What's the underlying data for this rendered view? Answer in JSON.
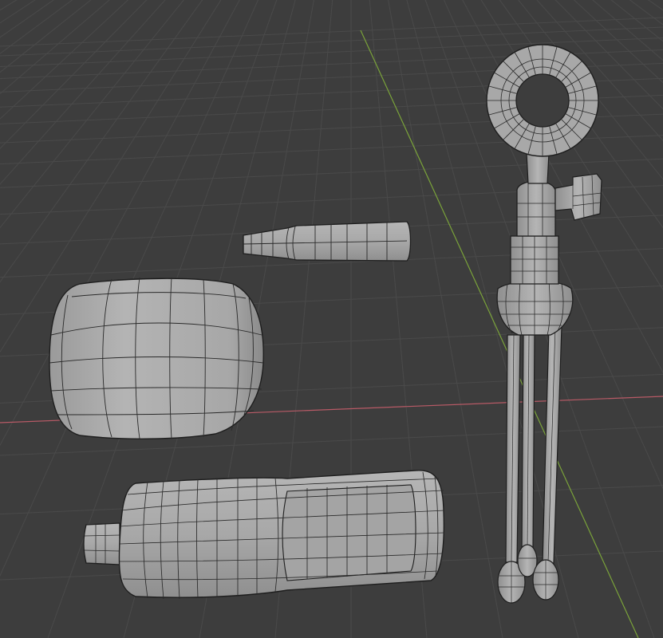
{
  "viewport": {
    "view": "3d-viewport",
    "shading": "solid",
    "overlay": "wireframe",
    "background_color": "#3d3d3d",
    "grid_color": "#4a4a4a",
    "x_axis_color": "#b85a66",
    "y_axis_color": "#7aa23a",
    "mesh_fill_color": "#a9a9a9",
    "mesh_wire_color": "#1e1e1e"
  },
  "objects": [
    {
      "name": "mic-head-mesh"
    },
    {
      "name": "connector-pin-mesh"
    },
    {
      "name": "mic-body-mesh"
    },
    {
      "name": "tripod-stand-mesh"
    }
  ]
}
